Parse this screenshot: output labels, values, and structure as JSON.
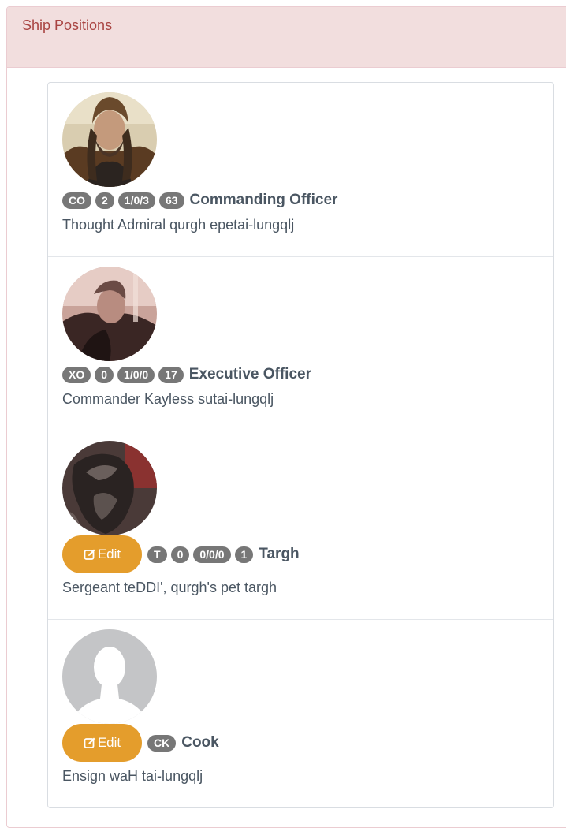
{
  "panel": {
    "title": "Ship Positions"
  },
  "positions": [
    {
      "abbr": "CO",
      "count1": "2",
      "ratio": "1/0/3",
      "count2": "63",
      "title": "Commanding Officer",
      "character": "Thought Admiral qurgh epetai-lungqlj",
      "avatar_icon": "officer-photo"
    },
    {
      "abbr": "XO",
      "count1": "0",
      "ratio": "1/0/0",
      "count2": "17",
      "title": "Executive Officer",
      "character": "Commander Kayless sutai-lungqlj",
      "avatar_icon": "officer-photo"
    },
    {
      "edit_label": "Edit",
      "abbr": "T",
      "count1": "0",
      "ratio": "0/0/0",
      "count2": "1",
      "title": "Targh",
      "character": "Sergeant teDDI', qurgh's pet targh",
      "avatar_icon": "targh-photo"
    },
    {
      "edit_label": "Edit",
      "abbr": "CK",
      "title": "Cook",
      "character": "Ensign waH tai-lungqlj",
      "avatar_icon": "placeholder-avatar"
    }
  ],
  "colors": {
    "heading_bg": "#f2dede",
    "heading_text": "#a94442",
    "badge": "#777777",
    "edit": "#e49d2c"
  }
}
